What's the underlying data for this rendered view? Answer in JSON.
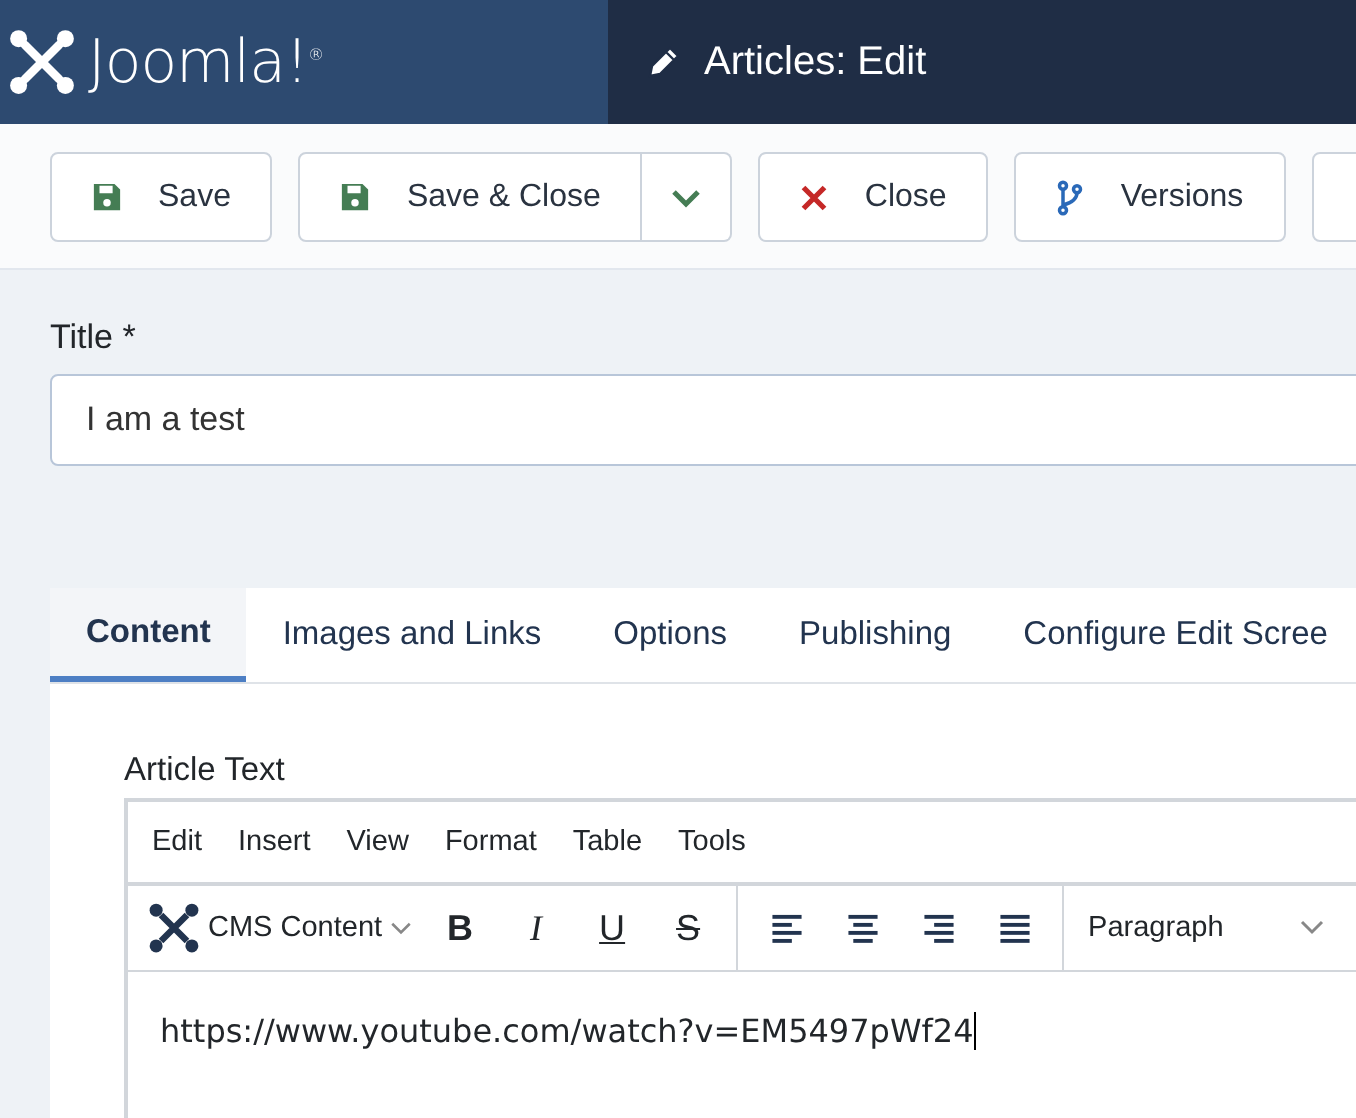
{
  "header": {
    "logo_text": "Joomla!$^{®}$",
    "title": "Articles: Edit"
  },
  "toolbar": {
    "buttons": [
      {
        "label": "Save",
        "kind": "save",
        "dropdown": false
      },
      {
        "label": "Save & Close",
        "kind": "save",
        "dropdown": true
      },
      {
        "label": "Close",
        "kind": "close",
        "dropdown": false
      },
      {
        "label": "Versions",
        "kind": "versions",
        "dropdown": false
      }
    ]
  },
  "title_field": {
    "label": "Title *",
    "value": "I am a test"
  },
  "tabs": [
    {
      "label": "Content",
      "selected": true
    },
    {
      "label": "Images and Links",
      "selected": false
    },
    {
      "label": "Options",
      "selected": false
    },
    {
      "label": "Publishing",
      "selected": false
    },
    {
      "label": "Configure Edit Scree",
      "selected": false
    }
  ],
  "editor": {
    "label": "Article Text",
    "menu": [
      "Edit",
      "Insert",
      "View",
      "Format",
      "Table",
      "Tools"
    ],
    "content_menu": "CMS Content",
    "format_buttons": [
      {
        "label": "B",
        "kind": "bold"
      },
      {
        "label": "I",
        "kind": "italic"
      },
      {
        "label": "U",
        "kind": "underline"
      },
      {
        "label": "S",
        "kind": "strike"
      }
    ],
    "align_buttons": [
      {
        "kind": "left"
      },
      {
        "kind": "center"
      },
      {
        "kind": "right"
      },
      {
        "kind": "justify"
      }
    ],
    "block_format": "Paragraph",
    "text": "https://www.youtube.com/watch?v=EM5497pWf24"
  }
}
